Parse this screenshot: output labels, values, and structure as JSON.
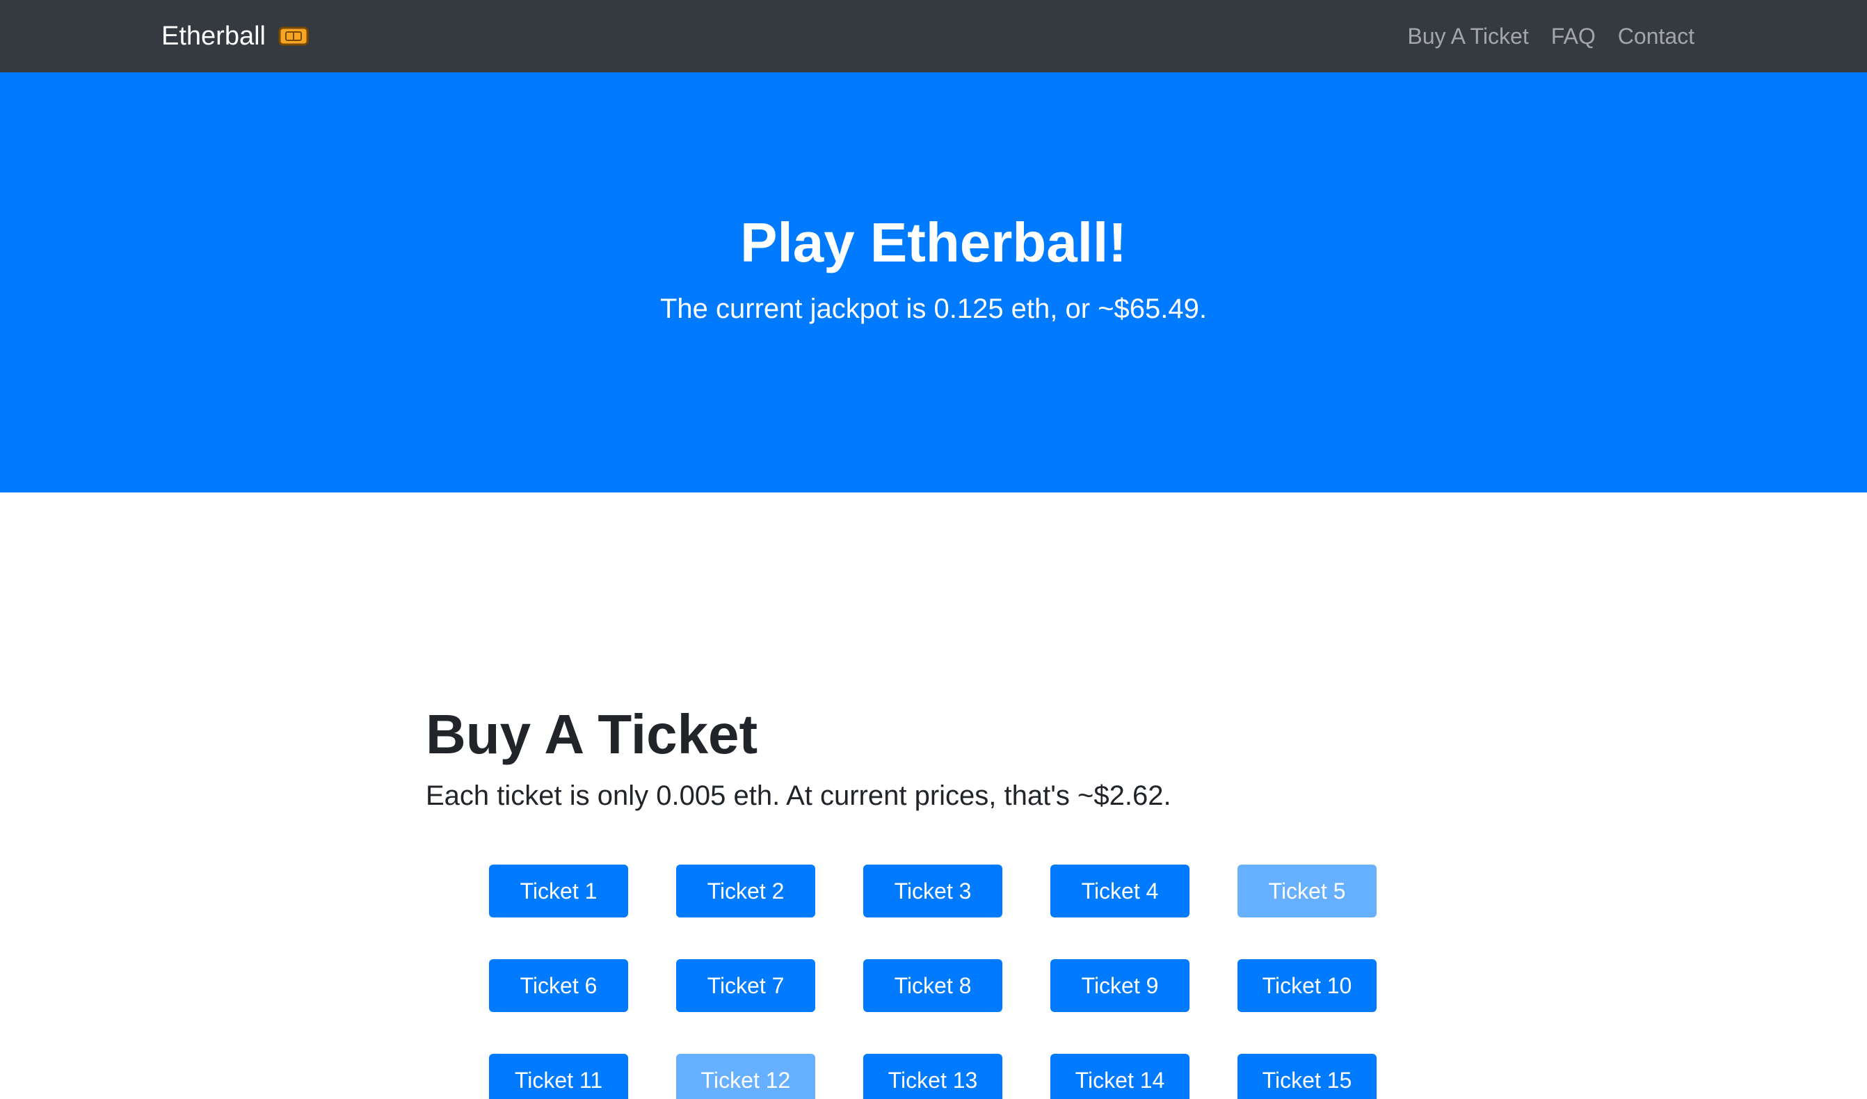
{
  "navbar": {
    "brand": "Etherball",
    "links": [
      "Buy A Ticket",
      "FAQ",
      "Contact"
    ]
  },
  "hero": {
    "title": "Play Etherball!",
    "subtitle": "The current jackpot is 0.125 eth, or ~$65.49."
  },
  "buy_section": {
    "title": "Buy A Ticket",
    "lead": "Each ticket is only 0.005 eth. At current prices, that's ~$2.62."
  },
  "tickets": [
    {
      "label": "Ticket 1",
      "available": true
    },
    {
      "label": "Ticket 2",
      "available": true
    },
    {
      "label": "Ticket 3",
      "available": true
    },
    {
      "label": "Ticket 4",
      "available": true
    },
    {
      "label": "Ticket 5",
      "available": false
    },
    {
      "label": "Ticket 6",
      "available": true
    },
    {
      "label": "Ticket 7",
      "available": true
    },
    {
      "label": "Ticket 8",
      "available": true
    },
    {
      "label": "Ticket 9",
      "available": true
    },
    {
      "label": "Ticket 10",
      "available": true
    },
    {
      "label": "Ticket 11",
      "available": true
    },
    {
      "label": "Ticket 12",
      "available": false
    },
    {
      "label": "Ticket 13",
      "available": true
    },
    {
      "label": "Ticket 14",
      "available": true
    },
    {
      "label": "Ticket 15",
      "available": true
    }
  ],
  "colors": {
    "navbar": "#343a40",
    "primary": "#007bff",
    "primary_disabled": "#66b0ff",
    "ticket_icon": "#f6a623"
  },
  "icons": {
    "brand": "ticket-icon"
  }
}
